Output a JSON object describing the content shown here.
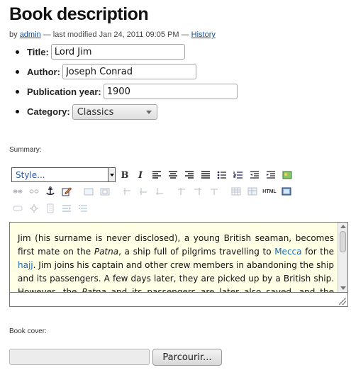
{
  "page": {
    "title": "Book description",
    "byline": {
      "prefix": "by",
      "author": "admin",
      "modified": "— last modified Jan 24, 2011 09:05 PM —",
      "history": "History"
    }
  },
  "form": {
    "title": {
      "label": "Title:",
      "value": "Lord Jim"
    },
    "author": {
      "label": "Author:",
      "value": "Joseph Conrad"
    },
    "year": {
      "label": "Publication year:",
      "value": "1900"
    },
    "category": {
      "label": "Category:",
      "value": "Classics"
    }
  },
  "summary": {
    "label": "Summary:",
    "style_select": "Style...",
    "html_button": "HTML",
    "content": {
      "t1": "Jim (his surname is never disclosed), a young British seaman, becomes first mate on the ",
      "patna": "Patna",
      "t2": ", a ship full of pilgrims travelling to ",
      "mecca": "Mecca",
      "t3": " for the ",
      "hajj": "hajj",
      "t4": ". Jim joins his captain and other crew members in abandoning the ship and its passengers. A few days later, they are picked up by a British ship. However, the ",
      "patna2": "Patna",
      "t5": " and its passengers are later also saved, and the reprehensible"
    }
  },
  "cover": {
    "label": "Book cover:",
    "browse": "Parcourir..."
  },
  "colors": {
    "link": "#1a4a8a",
    "editor_bg": "#ffffe6"
  },
  "toolbar_icons": [
    "bold-icon",
    "italic-icon",
    "align-left-icon",
    "align-center-icon",
    "align-right-icon",
    "justify-icon",
    "bullet-list-icon",
    "numbered-list-icon",
    "outdent-icon",
    "indent-icon",
    "image-icon",
    "link-icon",
    "anchor-icon",
    "edit-icon",
    "table-icon",
    "table-props-icon",
    "html-source-icon",
    "fullscreen-icon"
  ]
}
